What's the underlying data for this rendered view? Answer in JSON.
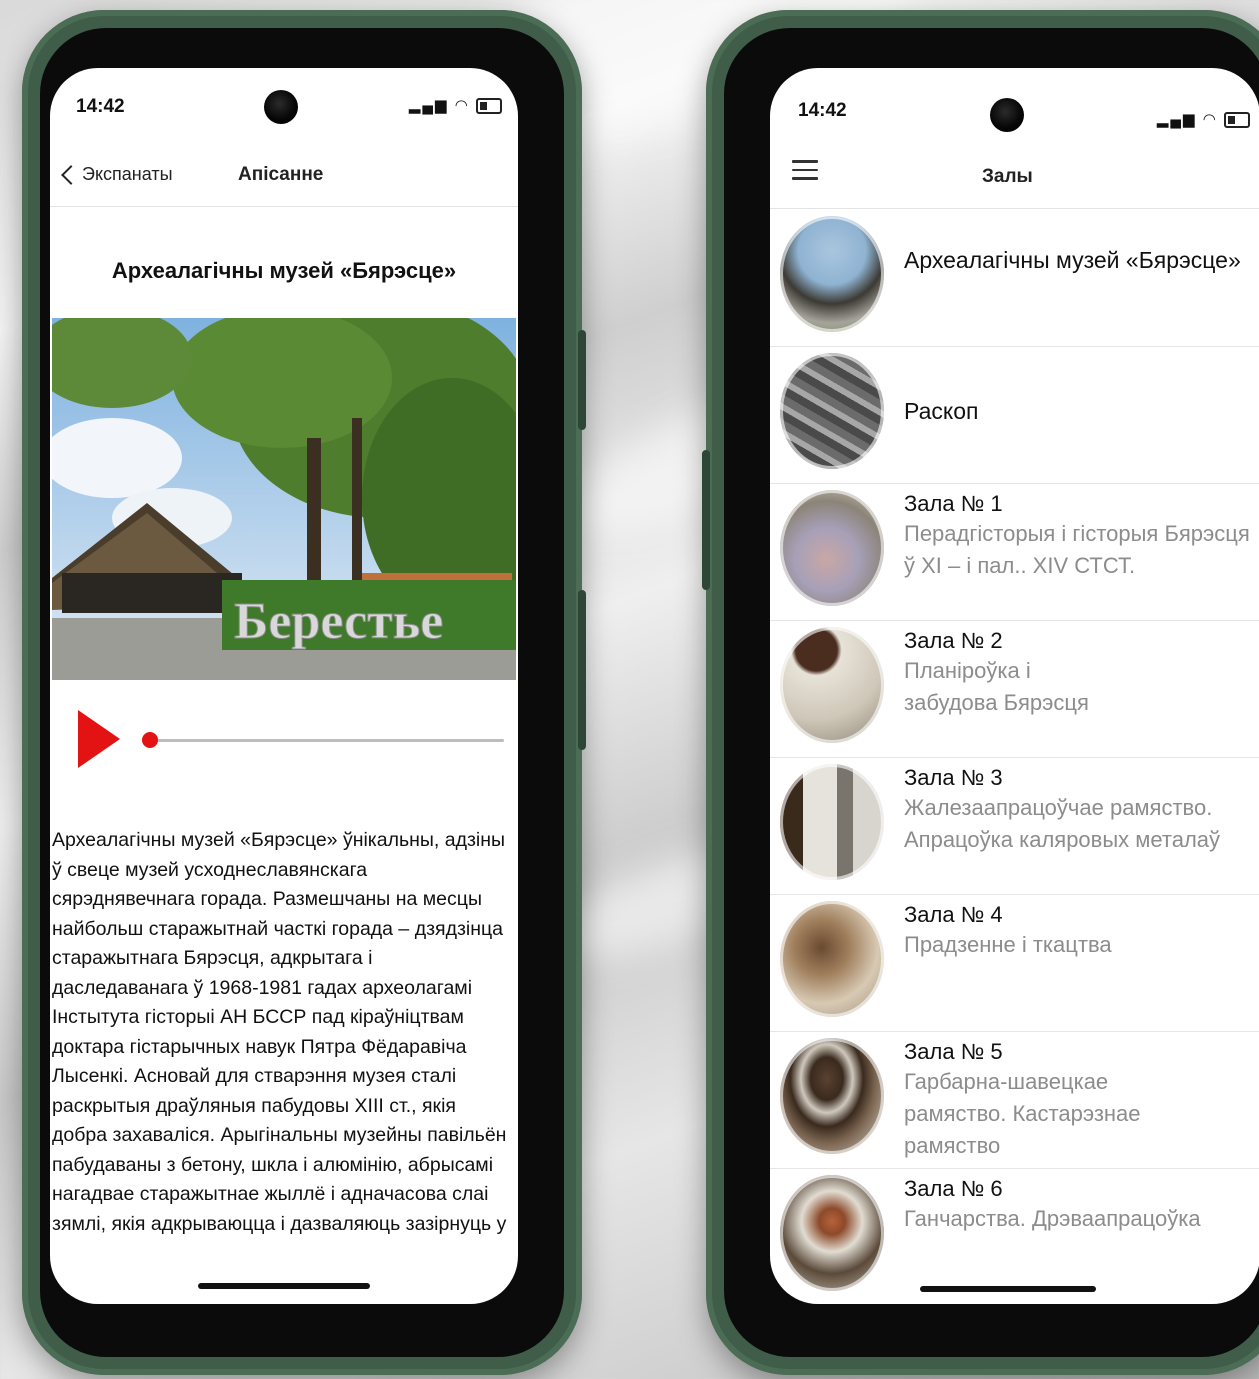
{
  "left_phone": {
    "status": {
      "time": "14:42"
    },
    "navbar": {
      "back_label": "Экспанаты",
      "title": "Апісанне"
    },
    "exhibit_title": "Археалагічны музей «Бярэсце»",
    "photo": {
      "sign_text": "Берестье",
      "icon": "museum-building-photo"
    },
    "player": {
      "play_icon": "play-icon",
      "progress": 0.0
    },
    "description": "Археалагічны музей «Бярэсце» ўнікальны, адзіны ў свеце музей усходнеславянскага сярэднявечнага горада. Размешчаны на месцы найбольш старажытнай часткі горада – дзядзінца старажытнага Бярэсця, адкрытага і даследаванага ў 1968-1981 гадах археолагамі Інстытута гісторыі АН БССР пад кіраўніцтвам доктара гістарычных навук Пятра Фёдаравіча Лысенкі. Асновай для стварэння музея сталі раскрытыя драўляныя пабудовы XIII ст., якія добра захаваліся. Арыгінальны музейны павільён пабудаваны з бетону, шкла і алюмінію, абрысамі нагадвае старажытнае жыллё і адначасова слаі зямлі, якія адкрываюцца і дазваляюць зазірнуць у"
  },
  "right_phone": {
    "status": {
      "time": "14:42"
    },
    "navbar": {
      "title": "Залы",
      "menu_icon": "hamburger-menu-icon"
    },
    "halls": [
      {
        "title": "Археалагічны музей «Бярэсце»",
        "desc": ""
      },
      {
        "title": "Раскоп",
        "desc": ""
      },
      {
        "title": "Зала № 1",
        "desc": "Перадгісторыя і гісторыя Бярэсця ў XI – і пал.. XIV СТСТ."
      },
      {
        "title": "Зала № 2",
        "desc": "Планіроўка і забудова Бярэсця"
      },
      {
        "title": "Зала № 3",
        "desc": "Жалезаапрацоўчае рамяство. Апрацоўка каляровых металаў"
      },
      {
        "title": "Зала № 4",
        "desc": "Прадзенне і ткацтва"
      },
      {
        "title": "Зала № 5",
        "desc": "Гарбарна-шавецкае рамяство. Кастарэзнае рамяство"
      },
      {
        "title": "Зала № 6",
        "desc": "Ганчарства. Дрэваапрацоўка"
      }
    ]
  },
  "colors": {
    "accent_red": "#e41313",
    "phone_green": "#3f5d48"
  }
}
